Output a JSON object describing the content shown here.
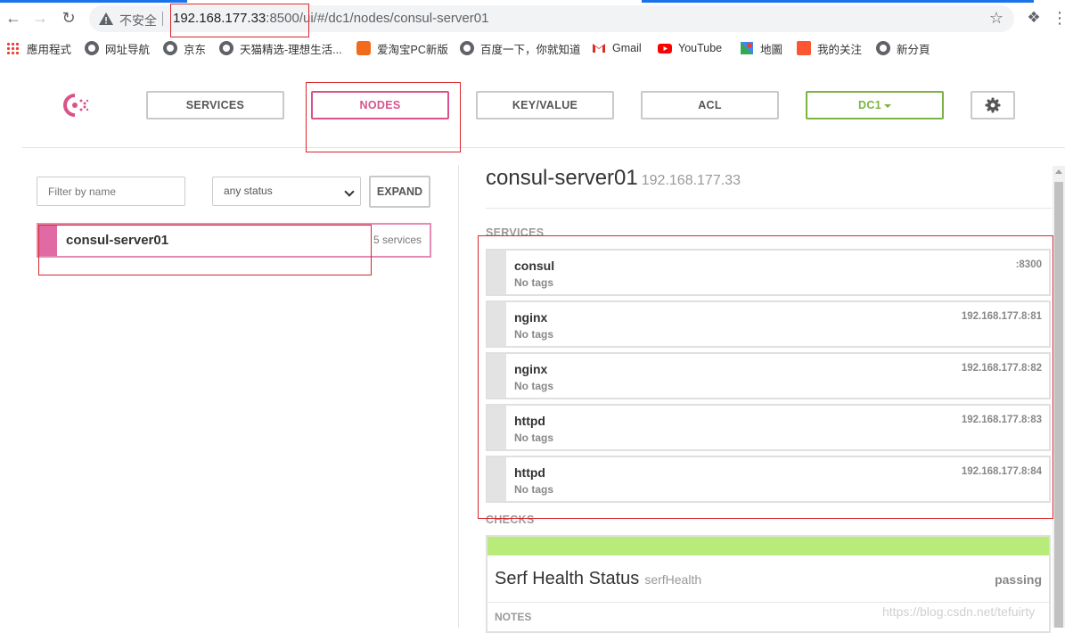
{
  "browser": {
    "back_icon": "arrow-left-icon",
    "forward_icon": "arrow-right-icon",
    "reload_icon": "reload-icon",
    "insecure_label": "不安全",
    "url_host": "192.168.177.33",
    "url_rest": ":8500/ui/#/dc1/nodes/consul-server01",
    "bookmark_icon": "star-icon",
    "extensions_icon": "puzzle-icon",
    "menu_icon": "more-vert-icon"
  },
  "bookmarks": [
    {
      "label": "應用程式",
      "icon": "apps-grid-icon"
    },
    {
      "label": "网址导航",
      "icon": "globe-icon"
    },
    {
      "label": "京东",
      "icon": "globe-icon"
    },
    {
      "label": "天猫精选-理想生活...",
      "icon": "globe-icon"
    },
    {
      "label": "爱淘宝PC新版",
      "icon": "taobao-icon"
    },
    {
      "label": "百度一下，你就知道",
      "icon": "globe-icon"
    },
    {
      "label": "Gmail",
      "icon": "gmail-icon"
    },
    {
      "label": "YouTube",
      "icon": "youtube-icon"
    },
    {
      "label": "地圖",
      "icon": "maps-icon"
    },
    {
      "label": "我的关注",
      "icon": "csdn-icon"
    },
    {
      "label": "新分頁",
      "icon": "globe-icon"
    }
  ],
  "nav": {
    "services": "SERVICES",
    "nodes": "NODES",
    "keyvalue": "KEY/VALUE",
    "acl": "ACL",
    "datacenter": "DC1",
    "active": "nodes"
  },
  "filters": {
    "name_placeholder": "Filter by name",
    "status_value": "any status",
    "expand_label": "EXPAND"
  },
  "nodes": [
    {
      "name": "consul-server01",
      "services_count": "5 services"
    }
  ],
  "detail": {
    "name": "consul-server01",
    "address": "192.168.177.33",
    "services_label": "SERVICES",
    "checks_label": "CHECKS",
    "services": [
      {
        "name": "consul",
        "tags": "No tags",
        "address": ":8300"
      },
      {
        "name": "nginx",
        "tags": "No tags",
        "address": "192.168.177.8:81"
      },
      {
        "name": "nginx",
        "tags": "No tags",
        "address": "192.168.177.8:82"
      },
      {
        "name": "httpd",
        "tags": "No tags",
        "address": "192.168.177.8:83"
      },
      {
        "name": "httpd",
        "tags": "No tags",
        "address": "192.168.177.8:84"
      }
    ],
    "checks": [
      {
        "name": "Serf Health Status",
        "id": "serfHealth",
        "status": "passing",
        "notes_label": "NOTES"
      }
    ]
  },
  "colors": {
    "brand_pink": "#d9538b",
    "dc_green": "#7cb342",
    "passing_green": "#b9eb7a",
    "annotation_red": "#d7262c"
  },
  "watermark": "https://blog.csdn.net/tefuirty"
}
